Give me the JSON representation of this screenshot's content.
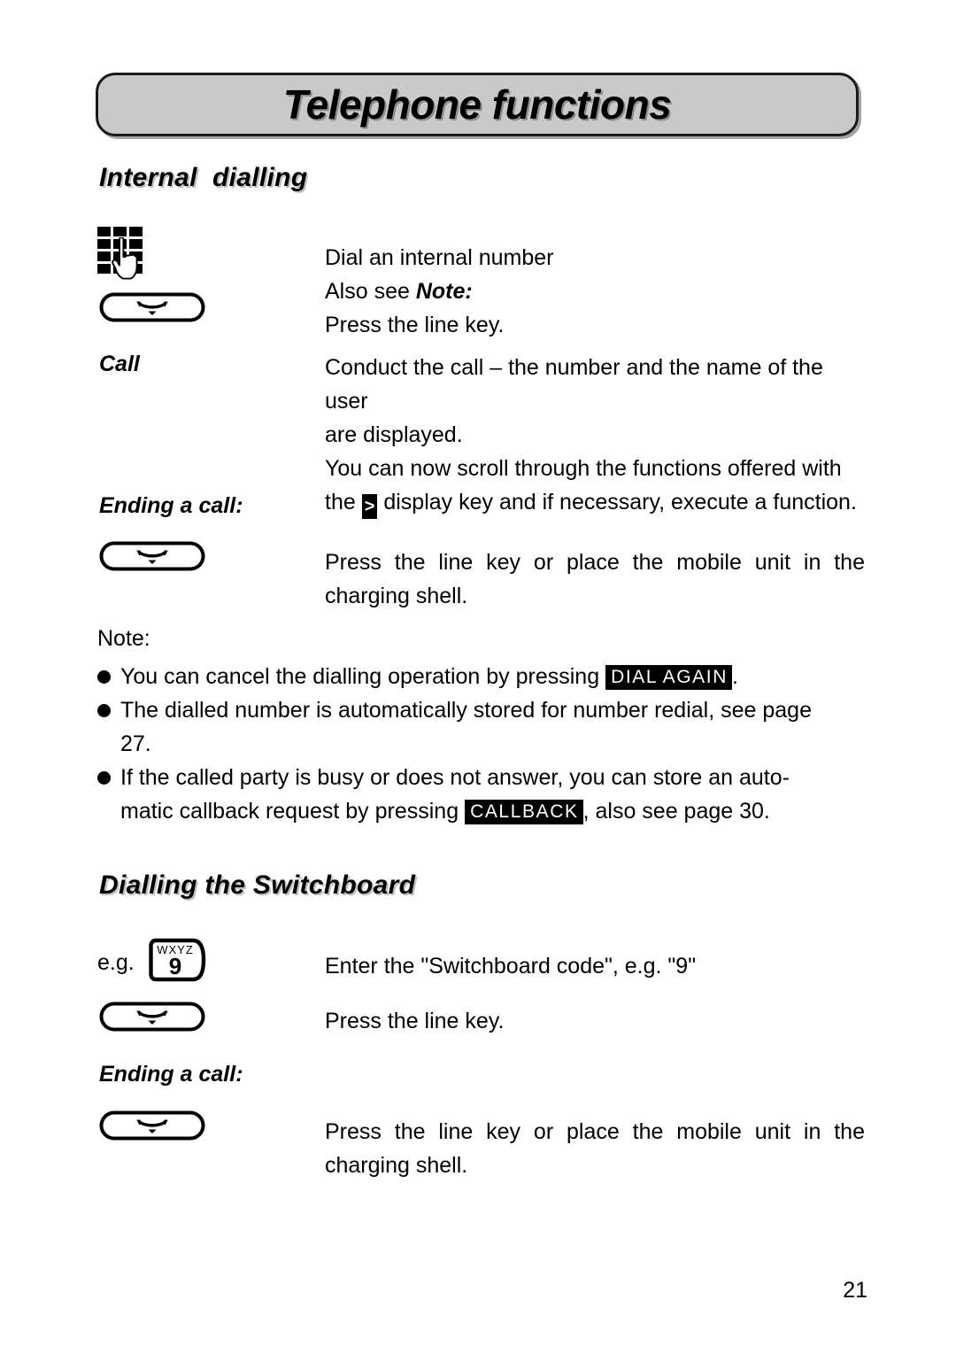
{
  "header": {
    "title": "Telephone functions"
  },
  "sections": [
    {
      "heading": "Internal  dialling",
      "rows": [
        {
          "icon": "keypad-hand-icon",
          "lines": [
            "Dial an internal number"
          ]
        },
        {
          "icon": "keypad-hand-icon-note",
          "lines_prefix": "Also see ",
          "lines_emphasis": "Note:"
        },
        {
          "icon": "line-key-icon",
          "lines": [
            "Press the line key."
          ]
        }
      ],
      "call_label": "Call",
      "call_text_line1": "Conduct the call – the number and the name of the user",
      "call_text_line2": "are displayed.",
      "call_text_line3": "You can now scroll through the functions offered with",
      "call_text_line4_pre": "the ",
      "call_text_line4_key": ">",
      "call_text_line4_post": " display key and if necessary, execute a function.",
      "ending_heading": "Ending a call:",
      "ending_text": "Press the line key or place the mobile unit in the",
      "ending_text_last": "charging shell."
    }
  ],
  "note": {
    "label": "Note:",
    "bullets": [
      {
        "pre": "You can cancel the dialling operation by pressing ",
        "key": "DIAL AGAIN",
        "post": "."
      },
      {
        "pre": "The dialled number is automatically stored for number redial, see page 27.",
        "key": "",
        "post": ""
      },
      {
        "pre": "If the called party is busy or does not answer, you can store an auto-matic callback request by pressing ",
        "key": "CALLBACK",
        "post": ", also see page 30."
      }
    ],
    "bullet3_line1": "If the called party is busy or does not answer, you can store an auto-",
    "bullet3_line2_pre": "matic callback request by pressing ",
    "bullet3_line2_key": "CALLBACK",
    "bullet3_line2_post": ", also see page 30.",
    "bullet2_line1": "The dialled number is automatically stored for number redial, see page",
    "bullet2_line2": "27.",
    "bullet_glyph": "●"
  },
  "switchboard": {
    "heading": "Dialling the Switchboard",
    "eg_label": "e.g.",
    "key_letters": "WXYZ",
    "key_digit": "9",
    "enter_code_text": "Enter the \"Switchboard code\", e.g. \"9\"",
    "press_line_key_text": "Press the line key.",
    "ending_heading": "Ending a call:",
    "ending_text": "Press the line key or place the mobile unit in the",
    "ending_text_last": "charging shell."
  },
  "footer": {
    "page_number": "21"
  },
  "colors": {
    "header_fill": "#c9c9c9",
    "ink": "#000000",
    "paper": "#ffffff"
  }
}
